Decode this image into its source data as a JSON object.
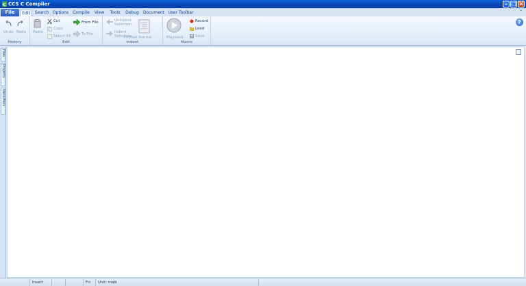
{
  "window": {
    "title": "CCS C Compiler",
    "controls": [
      "minimize-icon",
      "maximize-icon",
      "close-icon"
    ]
  },
  "tabs": {
    "file": "File",
    "items": [
      "Edit",
      "Search",
      "Options",
      "Compile",
      "View",
      "Tools",
      "Debug",
      "Document",
      "User Toolbar"
    ],
    "active": "Edit"
  },
  "ribbon": {
    "history": {
      "label": "History",
      "undo": "Undo",
      "redo": "Redo"
    },
    "edit": {
      "label": "Edit",
      "paste": "Paste",
      "cut": "Cut",
      "copy": "Copy",
      "select_all": "Select All",
      "from_file": "From File",
      "to_file": "To File"
    },
    "indent": {
      "label": "Indent",
      "unindent": [
        "Unindent",
        "Selection"
      ],
      "indent_sel": [
        "Indent",
        "Selection"
      ],
      "format_source": "Format Source"
    },
    "macro": {
      "label": "Macro",
      "playback": "Playback",
      "record": "Record",
      "load": "Load",
      "save": "Save"
    }
  },
  "side_tabs": [
    "Files",
    "Projects",
    "Identifiers"
  ],
  "status": {
    "mode": "Insert",
    "unit_prefix": "Fn:",
    "unit": "Unit: main"
  },
  "colors": {
    "titlebar": "#0a5fd8",
    "file_tab": "#2c5bc0",
    "ribbon": "#e3edf9",
    "accent_record": "#d9361e"
  }
}
